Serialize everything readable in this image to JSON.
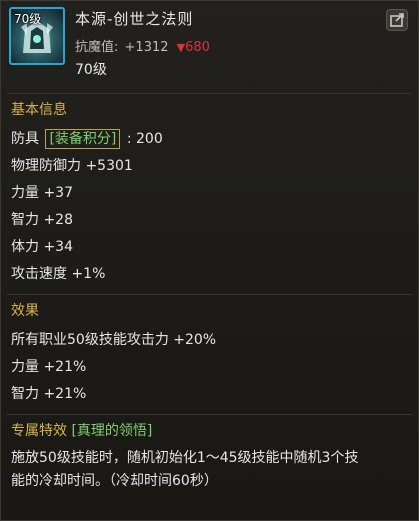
{
  "header": {
    "icon_level": "70级",
    "title": "本源-创世之法则",
    "resist_label": "抗魔值:",
    "resist_gain": "+1312",
    "resist_arrow": "▼",
    "resist_value": "680",
    "level": "70级"
  },
  "basic": {
    "title": "基本信息",
    "type_label": "防具",
    "score_tag": "[装备积分]",
    "score_value": ": 200",
    "stats": [
      "物理防御力 +5301",
      "力量 +37",
      "智力 +28",
      "体力 +34",
      "攻击速度 +1%"
    ]
  },
  "effect": {
    "title": "效果",
    "lines": [
      "所有职业50级技能攻击力 +20%",
      "力量 +21%",
      "智力 +21%"
    ]
  },
  "special": {
    "title": "专属特效",
    "tag": "[真理的领悟]",
    "desc_line1": "施放50级技能时，随机初始化1～45级技能中随机3个技",
    "desc_line2": "能的冷却时间。（冷却时间60秒）"
  },
  "icons": {
    "share": "share-icon",
    "item": "armor-item-icon"
  },
  "colors": {
    "section_title": "#d8b34a",
    "tag_green": "#7fd06a",
    "down_red": "#e0303a",
    "icon_border": "#2aa6d6"
  }
}
